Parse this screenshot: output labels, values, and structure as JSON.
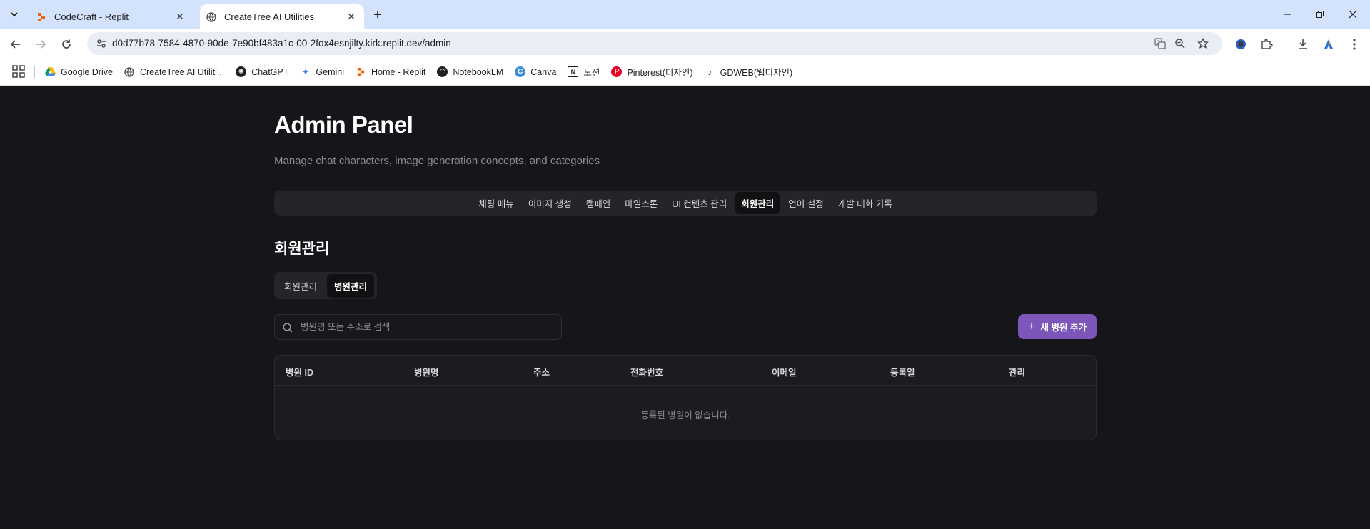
{
  "browser": {
    "tabs": [
      {
        "title": "CodeCraft - Replit",
        "active": false
      },
      {
        "title": "CreateTree AI Utilities",
        "active": true
      }
    ],
    "url": "d0d77b78-7584-4870-90de-7e90bf483a1c-00-2fox4esnjilty.kirk.replit.dev/admin",
    "bookmarks": [
      {
        "label": "Google Drive",
        "icon": "google-drive-icon"
      },
      {
        "label": "CreateTree AI Utiliti...",
        "icon": "globe-icon"
      },
      {
        "label": "ChatGPT",
        "icon": "chatgpt-icon"
      },
      {
        "label": "Gemini",
        "icon": "gemini-icon"
      },
      {
        "label": "Home - Replit",
        "icon": "replit-icon"
      },
      {
        "label": "NotebookLM",
        "icon": "notebooklm-icon"
      },
      {
        "label": "Canva",
        "icon": "canva-icon"
      },
      {
        "label": "노션",
        "icon": "notion-icon"
      },
      {
        "label": "Pinterest(디자인)",
        "icon": "pinterest-icon"
      },
      {
        "label": "GDWEB(웹디자인)",
        "icon": "gdweb-icon"
      }
    ]
  },
  "page": {
    "title": "Admin Panel",
    "subtitle": "Manage chat characters, image generation concepts, and categories",
    "main_tabs": [
      {
        "label": "채팅 메뉴",
        "active": false
      },
      {
        "label": "이미지 생성",
        "active": false
      },
      {
        "label": "캠페인",
        "active": false
      },
      {
        "label": "마일스톤",
        "active": false
      },
      {
        "label": "UI 컨텐츠 관리",
        "active": false
      },
      {
        "label": "회원관리",
        "active": true
      },
      {
        "label": "언어 설정",
        "active": false
      },
      {
        "label": "개발 대화 기록",
        "active": false
      }
    ],
    "section_title": "회원관리",
    "sub_tabs": [
      {
        "label": "회원관리",
        "active": false
      },
      {
        "label": "병원관리",
        "active": true
      }
    ],
    "search": {
      "placeholder": "병원명 또는 주소로 검색",
      "value": ""
    },
    "add_button": "새 병원 추가",
    "table": {
      "columns": [
        "병원 ID",
        "병원명",
        "주소",
        "전화번호",
        "이메일",
        "등록일",
        "관리"
      ],
      "rows": [],
      "empty_message": "등록된 병원이 없습니다."
    }
  },
  "colors": {
    "background": "#16161a",
    "accent": "#7c56b8",
    "tab_strip": "#d3e3fd"
  }
}
